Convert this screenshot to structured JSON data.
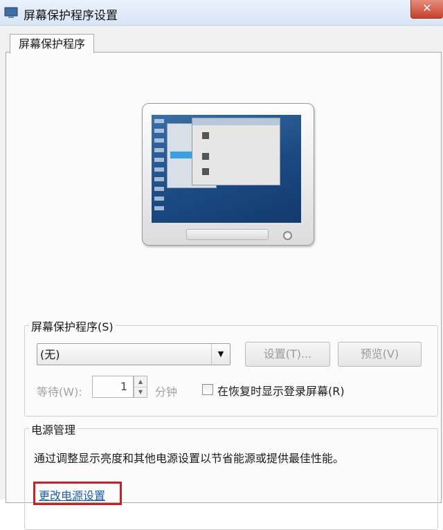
{
  "window": {
    "title": "屏幕保护程序设置",
    "close_glyph": "✕"
  },
  "tab": {
    "label": "屏幕保护程序"
  },
  "screensaver_group": {
    "label": "屏幕保护程序(S)",
    "selected": "(无)",
    "settings_button": "设置(T)...",
    "preview_button": "预览(V)",
    "wait_label": "等待(W):",
    "wait_value": "1",
    "minutes_label": "分钟",
    "resume_checkbox_label": "在恢复时显示登录屏幕(R)",
    "resume_checked": false
  },
  "power_group": {
    "label": "电源管理",
    "description": "通过调整显示亮度和其他电源设置以节省能源或提供最佳性能。",
    "link": "更改电源设置"
  },
  "colors": {
    "link": "#1a5fb4",
    "highlight_box": "#cc1f1f"
  }
}
